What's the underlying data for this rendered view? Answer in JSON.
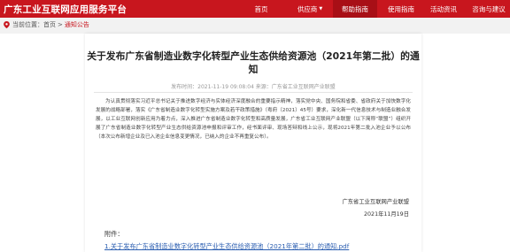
{
  "header": {
    "site_title": "广东工业互联网应用服务平台",
    "nav": [
      {
        "label": "首页",
        "has_dropdown": false,
        "active": false
      },
      {
        "label": "供应商",
        "has_dropdown": true,
        "active": false
      },
      {
        "label": "帮助指南",
        "has_dropdown": false,
        "active": true
      },
      {
        "label": "使用指南",
        "has_dropdown": false,
        "active": false
      },
      {
        "label": "活动资讯",
        "has_dropdown": false,
        "active": false
      },
      {
        "label": "咨询与建议",
        "has_dropdown": false,
        "active": false
      }
    ]
  },
  "breadcrumb": {
    "prefix": "当前位置：",
    "items": [
      "首页",
      "通知公告"
    ],
    "separator": ">"
  },
  "article": {
    "title": "关于发布广东省制造业数字化转型产业生态供给资源池（2021年第二批）的通知",
    "meta": "发布时间：2021-11-19 09:08:04    来源：广东省工业互联网产业联盟",
    "body": "为认真贯彻落实习近平总书记关于推进数字经济与实体经济深度融合的重要指示精神，落实党中央、国务院和省委、省政府关于加快数字化发展的战略部署，落实《广东省制造业数字化转型实施方案及若干政策措施》（粤府〔2021〕45号）要求，深化新一代信息技术与制造业融合发展，以工业互联网创新应用为着力点，深入推进广东省制造业数字化转型和高质量发展，广东省工业互联网产业联盟（以下简称“联盟”）组织开展了广东省制造业数字化转型产业生态供给资源池申报和评审工作，经书面评审、现场答辩和线上公示，现将2021年第二批入池企业予以公布（本次公布新增企业及已入池企业信息变更情况，已纳入的企业不再重复公布）。",
    "signer": "广东省工业互联网产业联盟",
    "date": "2021年11月19日",
    "attachments_label": "附件：",
    "attachments": [
      "1.关于发布广东省制造业数字化转型产业生态供给资源池（2021年第二批）的通知.pdf"
    ]
  },
  "colors": {
    "brand": "#c8161e",
    "brand_dark": "#a80f16",
    "link": "#2a5db0"
  }
}
